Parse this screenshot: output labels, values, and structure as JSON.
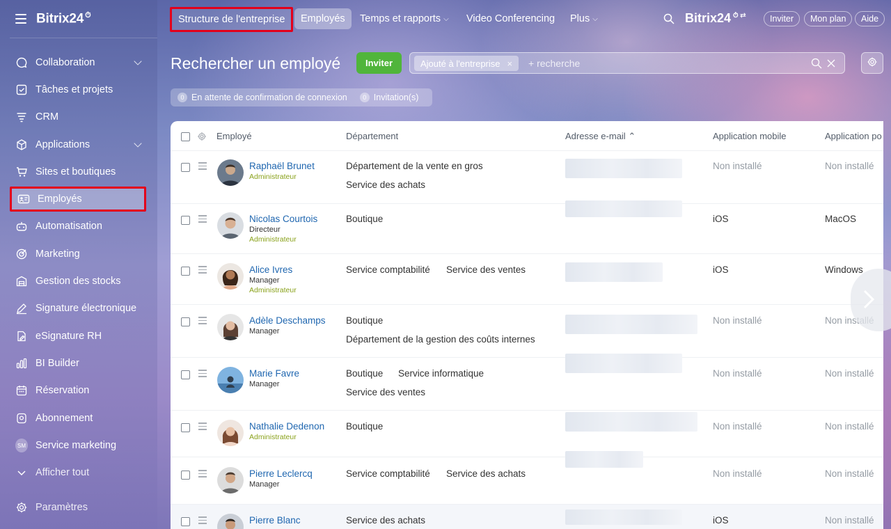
{
  "brand": {
    "name": "Bitrix24",
    "clock": "⏱"
  },
  "sidebar": {
    "items": [
      {
        "label": "Collaboration",
        "icon": "chat-icon",
        "has_chevron": true
      },
      {
        "label": "Tâches et projets",
        "icon": "task-icon"
      },
      {
        "label": "CRM",
        "icon": "crm-filter-icon"
      },
      {
        "label": "Applications",
        "icon": "cube-icon",
        "has_chevron": true
      },
      {
        "label": "Sites et boutiques",
        "icon": "cart-icon"
      },
      {
        "label": "Employés",
        "icon": "id-card-icon",
        "active": true
      },
      {
        "label": "Automatisation",
        "icon": "robot-icon"
      },
      {
        "label": "Marketing",
        "icon": "target-icon"
      },
      {
        "label": "Gestion des stocks",
        "icon": "warehouse-icon"
      },
      {
        "label": "Signature électronique",
        "icon": "pen-icon"
      },
      {
        "label": "eSignature RH",
        "icon": "document-sign-icon"
      },
      {
        "label": "BI Builder",
        "icon": "bar-chart-icon"
      },
      {
        "label": "Réservation",
        "icon": "calendar-icon"
      },
      {
        "label": "Abonnement",
        "icon": "subscription-icon"
      },
      {
        "label": "Service marketing",
        "icon": "sm-badge-icon",
        "badge": "SM"
      },
      {
        "label": "Afficher tout",
        "icon": "chevron-down-icon"
      },
      {
        "label": "Paramètres",
        "icon": "gear-icon"
      }
    ]
  },
  "topnav": {
    "items": [
      {
        "label": "Structure de l'entreprise"
      },
      {
        "label": "Employés"
      },
      {
        "label": "Temps et rapports",
        "dropdown": "⌵"
      },
      {
        "label": "Video Conferencing"
      },
      {
        "label": "Plus",
        "dropdown": "⌵"
      }
    ],
    "brand": "Bitrix24",
    "buttons": {
      "invite": "Inviter",
      "plan": "Mon plan",
      "help": "Aide"
    }
  },
  "page": {
    "title": "Rechercher un employé",
    "invite_button": "Inviter",
    "filter": {
      "tag": "Ajouté à l'entreprise",
      "tag_close": "×",
      "placeholder": "+ recherche"
    },
    "counters": [
      {
        "count": "0",
        "label": "En attente de confirmation de connexion"
      },
      {
        "count": "0",
        "label": "Invitation(s)"
      }
    ]
  },
  "grid": {
    "columns": {
      "employee": "Employé",
      "department": "Département",
      "email": "Adresse e-mail",
      "email_sort": "⌃",
      "mobile": "Application mobile",
      "desktop": "Application po"
    },
    "rows": [
      {
        "name": "Raphaël Brunet",
        "position": "",
        "admin": "Administrateur",
        "depts": [
          "Département de la vente en gros",
          "Service des achats"
        ],
        "mobile": "Non installé",
        "desktop": "Non installé"
      },
      {
        "name": "Nicolas Courtois",
        "position": "Directeur",
        "admin": "Administrateur",
        "depts": [
          "Boutique"
        ],
        "mobile": "iOS",
        "desktop": "MacOS"
      },
      {
        "name": "Alice Ivres",
        "position": "Manager",
        "admin": "Administrateur",
        "depts": [
          "Service comptabilité",
          "Service des ventes"
        ],
        "mobile": "iOS",
        "desktop": "Windows"
      },
      {
        "name": "Adèle Deschamps",
        "position": "Manager",
        "admin": "",
        "depts": [
          "Boutique",
          "Département de la gestion des coûts internes"
        ],
        "mobile": "Non installé",
        "desktop": "Non installé"
      },
      {
        "name": "Marie Favre",
        "position": "Manager",
        "admin": "",
        "depts": [
          "Boutique",
          "Service informatique",
          "Service des ventes"
        ],
        "mobile": "Non installé",
        "desktop": "Non installé"
      },
      {
        "name": "Nathalie Dedenon",
        "position": "",
        "admin": "Administrateur",
        "depts": [
          "Boutique"
        ],
        "mobile": "Non installé",
        "desktop": "Non installé"
      },
      {
        "name": "Pierre Leclercq",
        "position": "Manager",
        "admin": "",
        "depts": [
          "Service comptabilité",
          "Service des achats"
        ],
        "mobile": "Non installé",
        "desktop": "Non installé"
      },
      {
        "name": "Pierre Blanc",
        "position": "",
        "admin": "",
        "depts": [
          "Service des achats"
        ],
        "mobile": "iOS",
        "desktop": "Non installé"
      }
    ]
  },
  "colors": {
    "accent_green": "#50b53b",
    "link_blue": "#2067b0",
    "admin_green": "#8aa21c",
    "highlight_red": "#e3001b"
  }
}
